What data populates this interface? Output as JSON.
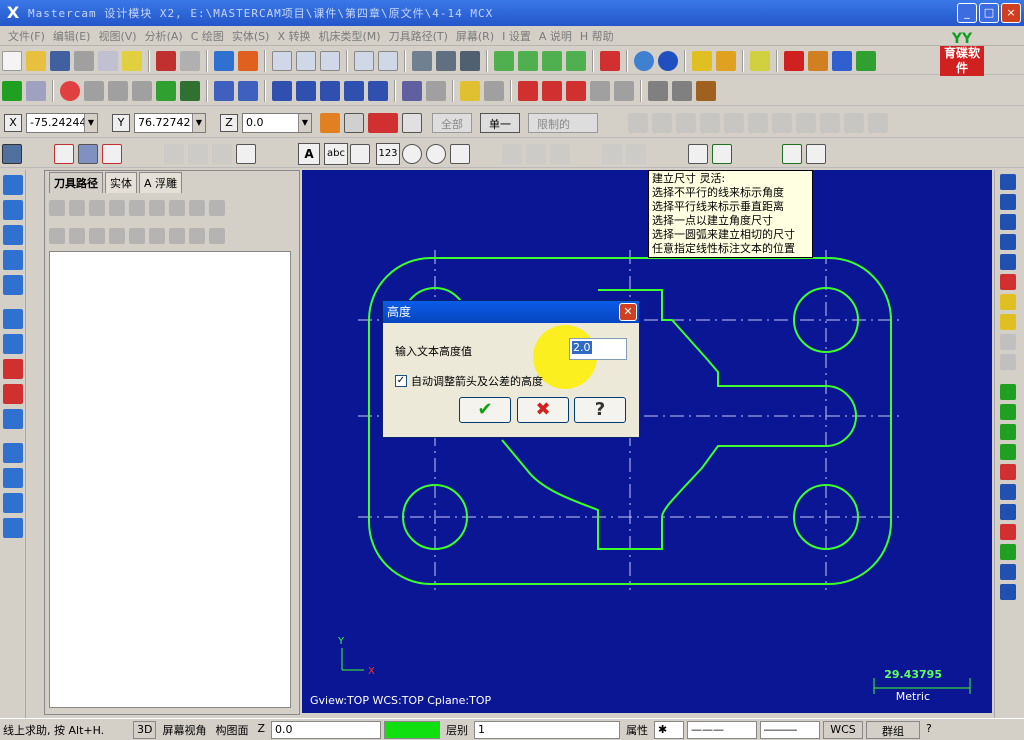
{
  "window": {
    "title": "Mastercam 设计模块 X2, E:\\MASTERCAM项目\\课件\\第四章\\原文件\\4-14 MCX",
    "min": "_",
    "max": "□",
    "close": "×"
  },
  "menu": [
    "文件(F)",
    "编辑(E)",
    "视图(V)",
    "分析(A)",
    "C 绘图",
    "实体(S)",
    "X 转换",
    "机床类型(M)",
    "刀具路径(T)",
    "屏幕(R)",
    "I 设置",
    "A 说明",
    "H 帮助"
  ],
  "brand": {
    "top": "YY",
    "text": "育碟软件"
  },
  "coords": {
    "x_label": "X",
    "x_value": "-75.24244",
    "y_label": "Y",
    "y_value": "76.72742",
    "z_label": "Z",
    "z_value": "0.0"
  },
  "toolbar4": {
    "btn1": "全部",
    "btn2": "单一",
    "btn3": "限制的"
  },
  "dim_buttons": [
    "A",
    "abc",
    "123"
  ],
  "panel": {
    "tabs": [
      "刀具路径",
      "实体",
      "A 浮雕"
    ]
  },
  "tooltip": [
    "建立尺寸  灵活:",
    "选择不平行的线来标示角度",
    "选择平行线来标示垂直距离",
    "选择一点以建立角度尺寸",
    "选择一圆弧来建立相切的尺寸",
    "任意指定线性标注文本的位置"
  ],
  "dialog": {
    "title": "高度",
    "label": "输入文本高度值",
    "value": "2.0",
    "checkbox": "自动调整箭头及公差的高度",
    "checked": true,
    "ok": "✔",
    "cancel": "✖",
    "help": "?"
  },
  "viewinfo": "Gview:TOP   WCS:TOP   Cplane:TOP",
  "scale": {
    "value": "29.43795",
    "unit": "Metric"
  },
  "axes": {
    "y": "Y",
    "x": "X"
  },
  "status": {
    "help": "线上求助, 按 Alt+H.",
    "mode3d": "3D",
    "screen_view": "屏幕视角",
    "cplane": "构图面",
    "z_label": "Z",
    "z_value": "0.0",
    "level_label": "层别",
    "level_value": "1",
    "attr": "属性",
    "wcs": "WCS",
    "group": "群组",
    "q": "?"
  },
  "colors": {
    "canvas": "#0a1693",
    "geometry": "#3cff2c",
    "centerline": "#c8c8ff"
  }
}
